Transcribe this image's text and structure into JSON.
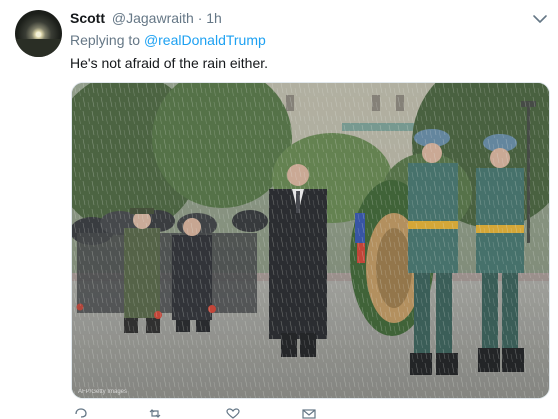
{
  "tweet": {
    "display_name": "Scott",
    "handle": "@Jagawraith",
    "separator": "·",
    "time": "1h",
    "replying_prefix": "Replying to",
    "replying_to": "@realDonaldTrump",
    "text": "He's not afraid of the rain either.",
    "media": {
      "credit": "AFP/Getty Images"
    }
  },
  "icons": {
    "menu": "chevron-down-icon",
    "actions": [
      "reply-icon",
      "retweet-icon",
      "like-icon",
      "direct-message-icon"
    ]
  },
  "colors": {
    "link": "#1da1f2",
    "secondary_text": "#657786",
    "primary_text": "#14171a"
  }
}
